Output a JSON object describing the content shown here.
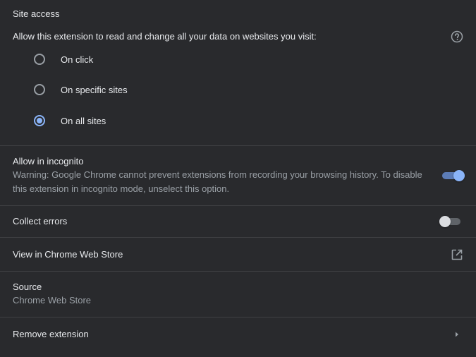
{
  "site_access": {
    "heading": "Site access",
    "question": "Allow this extension to read and change all your data on websites you visit:",
    "help_icon": "help-circle-icon",
    "options": [
      {
        "label": "On click",
        "selected": false
      },
      {
        "label": "On specific sites",
        "selected": false
      },
      {
        "label": "On all sites",
        "selected": true
      }
    ]
  },
  "incognito": {
    "title": "Allow in incognito",
    "warning": "Warning: Google Chrome cannot prevent extensions from recording your browsing history. To disable this extension in incognito mode, unselect this option.",
    "enabled": true
  },
  "collect_errors": {
    "title": "Collect errors",
    "enabled": false
  },
  "web_store": {
    "title": "View in Chrome Web Store",
    "icon": "open-in-new-icon"
  },
  "source": {
    "title": "Source",
    "value": "Chrome Web Store"
  },
  "remove": {
    "title": "Remove extension",
    "icon": "chevron-right-icon"
  },
  "colors": {
    "background": "#292a2d",
    "accent": "#8ab4f8",
    "text": "#e8eaed",
    "secondary_text": "#9aa0a6",
    "divider": "#3f4043"
  }
}
